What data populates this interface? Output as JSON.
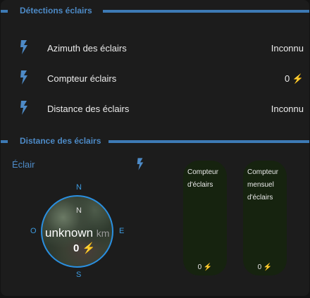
{
  "section1": {
    "title": "Détections éclairs",
    "rows": [
      {
        "label": "Azimuth des éclairs",
        "value": "Inconnu"
      },
      {
        "label": "Compteur éclairs",
        "value": "0 ⚡"
      },
      {
        "label": "Distance des éclairs",
        "value": "Inconnu"
      }
    ]
  },
  "section2": {
    "title": "Distance des éclairs",
    "eclair_label": "Éclair",
    "compass": {
      "north": "N",
      "south": "S",
      "east": "E",
      "west": "O",
      "inner_north": "N",
      "distance_value": "unknown",
      "distance_unit": "km",
      "count": "0 ⚡"
    },
    "gauges": [
      {
        "title": "Compteur d'éclairs",
        "value": "0 ⚡"
      },
      {
        "title": "Compteur mensuel d'éclairs",
        "value": "0 ⚡"
      }
    ]
  },
  "colors": {
    "accent": "#3d7ab5",
    "accent_text": "#4d8ac6",
    "gauge_bg": "#16230f"
  },
  "icons": {
    "row_icon": "lightning-bolt-icon"
  }
}
